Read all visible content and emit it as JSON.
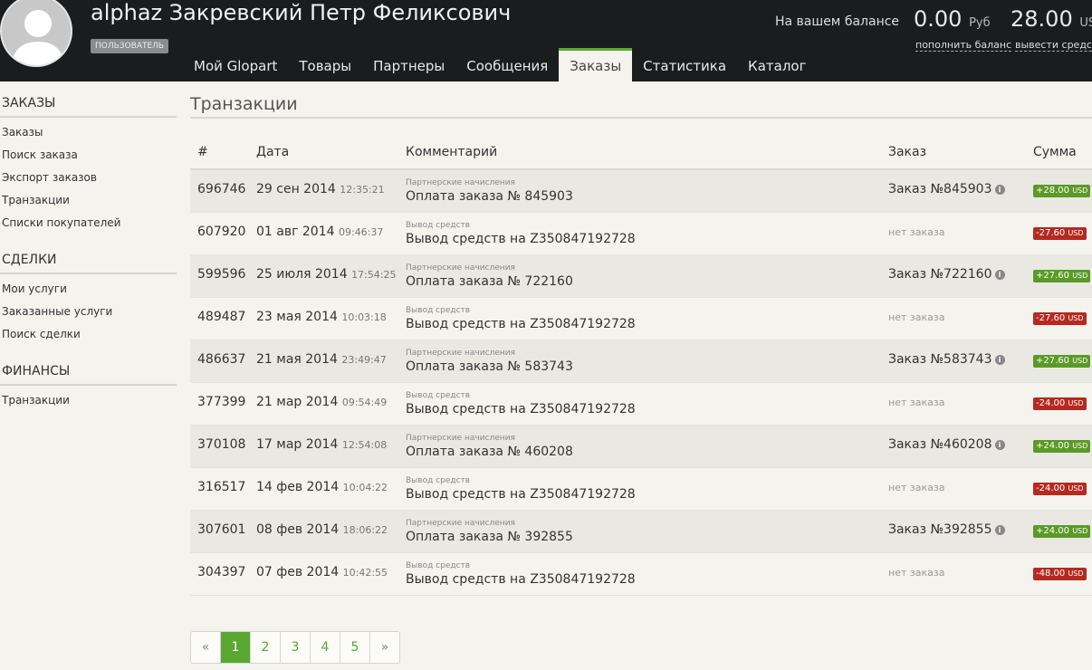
{
  "header": {
    "user_name": "alphaz Закревский Петр Феликсович",
    "role_badge": "ПОЛЬЗОВАТЕЛЬ",
    "balance_label": "На вашем балансе",
    "balance_rub": "0.00",
    "currency_rub": "Руб",
    "balance_usd": "28.00",
    "currency_usd": "USD",
    "topup_link": "пополнить баланс",
    "withdraw_link": "вывести средства"
  },
  "nav": [
    {
      "label": "Мой Glopart"
    },
    {
      "label": "Товары"
    },
    {
      "label": "Партнеры"
    },
    {
      "label": "Сообщения"
    },
    {
      "label": "Заказы",
      "active": true
    },
    {
      "label": "Статистика"
    },
    {
      "label": "Каталог"
    }
  ],
  "sidebar": [
    {
      "heading": "ЗАКАЗЫ",
      "items": [
        "Заказы",
        "Поиск заказа",
        "Экспорт заказов",
        "Транзакции",
        "Списки покупателей"
      ]
    },
    {
      "heading": "СДЕЛКИ",
      "items": [
        "Мои услуги",
        "Заказанные услуги",
        "Поиск сделки"
      ]
    },
    {
      "heading": "ФИНАНСЫ",
      "items": [
        "Транзакции"
      ]
    }
  ],
  "page_title": "Транзакции",
  "table": {
    "headers": {
      "id": "#",
      "date": "Дата",
      "comment": "Комментарий",
      "order": "Заказ",
      "amount": "Сумма"
    },
    "rows": [
      {
        "id": "696746",
        "date": "29 сен 2014",
        "time": "12:35:21",
        "type": "Партнерские начисления",
        "comment": "Оплата заказа № 845903",
        "order": "Заказ №845903",
        "has_order": true,
        "amount": "+28.00",
        "unit": "USD",
        "positive": true
      },
      {
        "id": "607920",
        "date": "01 авг 2014",
        "time": "09:46:37",
        "type": "Вывод средств",
        "comment": "Вывод средств на Z350847192728",
        "order": "нет заказа",
        "has_order": false,
        "amount": "-27.60",
        "unit": "USD",
        "positive": false
      },
      {
        "id": "599596",
        "date": "25 июля 2014",
        "time": "17:54:25",
        "type": "Партнерские начисления",
        "comment": "Оплата заказа № 722160",
        "order": "Заказ №722160",
        "has_order": true,
        "amount": "+27.60",
        "unit": "USD",
        "positive": true
      },
      {
        "id": "489487",
        "date": "23 мая 2014",
        "time": "10:03:18",
        "type": "Вывод средств",
        "comment": "Вывод средств на Z350847192728",
        "order": "нет заказа",
        "has_order": false,
        "amount": "-27.60",
        "unit": "USD",
        "positive": false
      },
      {
        "id": "486637",
        "date": "21 мая 2014",
        "time": "23:49:47",
        "type": "Партнерские начисления",
        "comment": "Оплата заказа № 583743",
        "order": "Заказ №583743",
        "has_order": true,
        "amount": "+27.60",
        "unit": "USD",
        "positive": true
      },
      {
        "id": "377399",
        "date": "21 мар 2014",
        "time": "09:54:49",
        "type": "Вывод средств",
        "comment": "Вывод средств на Z350847192728",
        "order": "нет заказа",
        "has_order": false,
        "amount": "-24.00",
        "unit": "USD",
        "positive": false
      },
      {
        "id": "370108",
        "date": "17 мар 2014",
        "time": "12:54:08",
        "type": "Партнерские начисления",
        "comment": "Оплата заказа № 460208",
        "order": "Заказ №460208",
        "has_order": true,
        "amount": "+24.00",
        "unit": "USD",
        "positive": true
      },
      {
        "id": "316517",
        "date": "14 фев 2014",
        "time": "10:04:22",
        "type": "Вывод средств",
        "comment": "Вывод средств на Z350847192728",
        "order": "нет заказа",
        "has_order": false,
        "amount": "-24.00",
        "unit": "USD",
        "positive": false
      },
      {
        "id": "307601",
        "date": "08 фев 2014",
        "time": "18:06:22",
        "type": "Партнерские начисления",
        "comment": "Оплата заказа № 392855",
        "order": "Заказ №392855",
        "has_order": true,
        "amount": "+24.00",
        "unit": "USD",
        "positive": true
      },
      {
        "id": "304397",
        "date": "07 фев 2014",
        "time": "10:42:55",
        "type": "Вывод средств",
        "comment": "Вывод средств на Z350847192728",
        "order": "нет заказа",
        "has_order": false,
        "amount": "-48.00",
        "unit": "USD",
        "positive": false
      }
    ]
  },
  "pagination": {
    "prev": "«",
    "pages": [
      "1",
      "2",
      "3",
      "4",
      "5"
    ],
    "current": "1",
    "next": "»"
  },
  "colors": {
    "accent": "#5aa832",
    "header_bg": "#1b1c1e",
    "positive": "#5b9a26",
    "negative": "#b52a20"
  },
  "icons": {
    "order_info": "info-icon",
    "avatar": "user-silhouette-icon"
  }
}
